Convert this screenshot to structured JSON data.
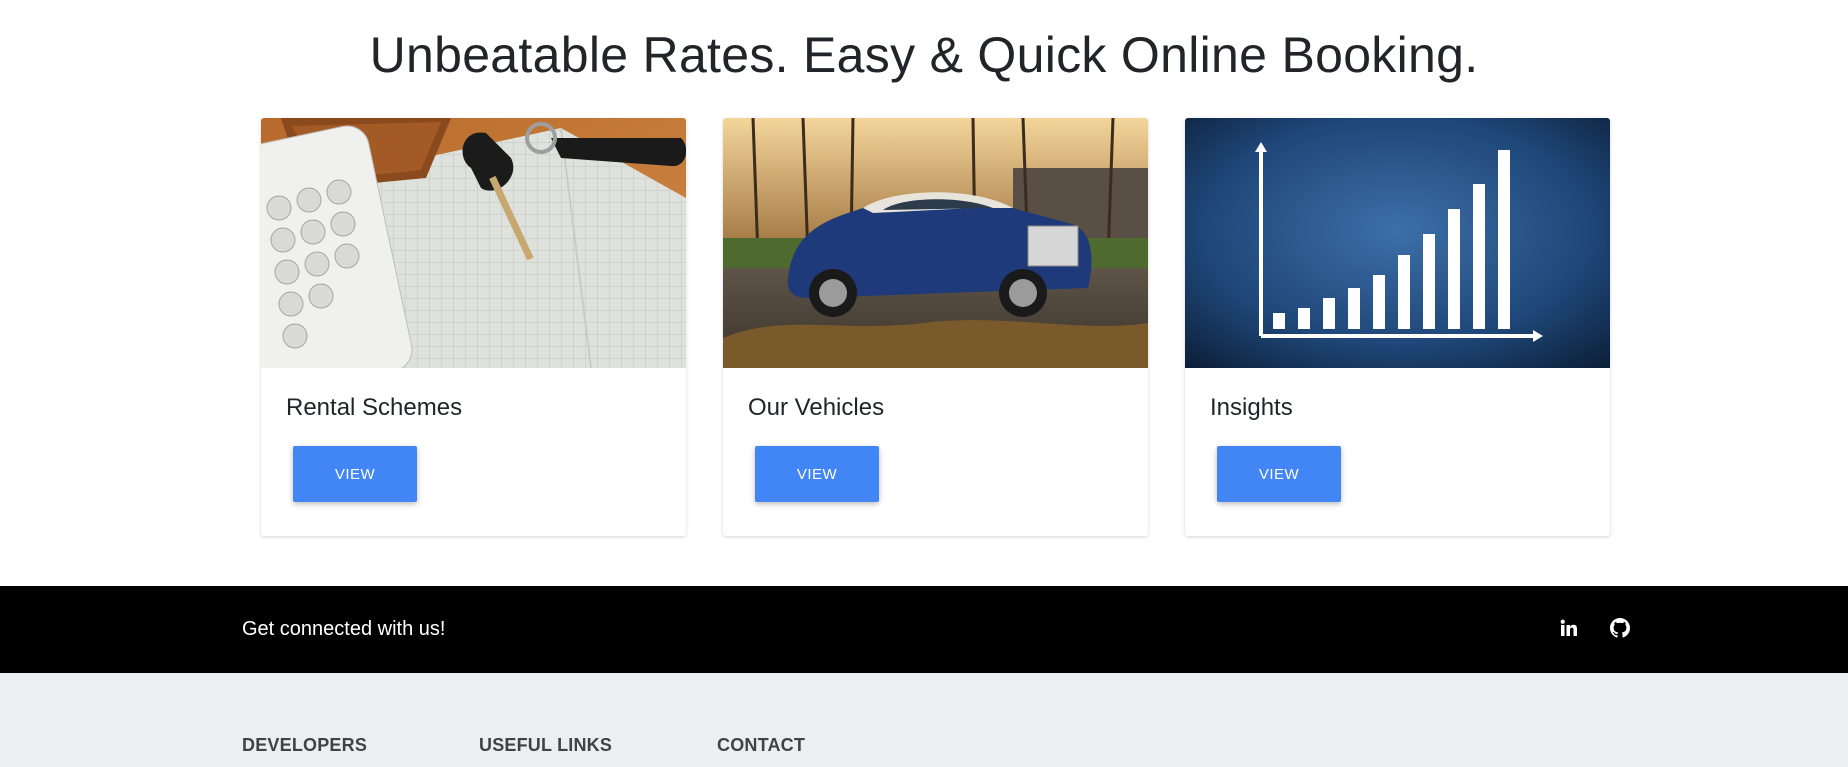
{
  "hero": {
    "headline": "Unbeatable Rates. Easy & Quick Online Booking."
  },
  "cards": [
    {
      "title": "Rental Schemes",
      "button": "VIEW",
      "image": "calculator-notebook-car-key-photo"
    },
    {
      "title": "Our Vehicles",
      "button": "VIEW",
      "image": "blue-luxury-sedan-photo"
    },
    {
      "title": "Insights",
      "button": "VIEW",
      "image": "rising-bar-chart-illustration"
    }
  ],
  "connect": {
    "text": "Get connected with us!",
    "icons": [
      "linkedin-icon",
      "github-icon"
    ]
  },
  "footer": {
    "columns": [
      "DEVELOPERS",
      "USEFUL LINKS",
      "CONTACT"
    ]
  },
  "colors": {
    "accent": "#4285f4",
    "connect_bar": "#000000",
    "footer_bg": "#eceff1"
  }
}
